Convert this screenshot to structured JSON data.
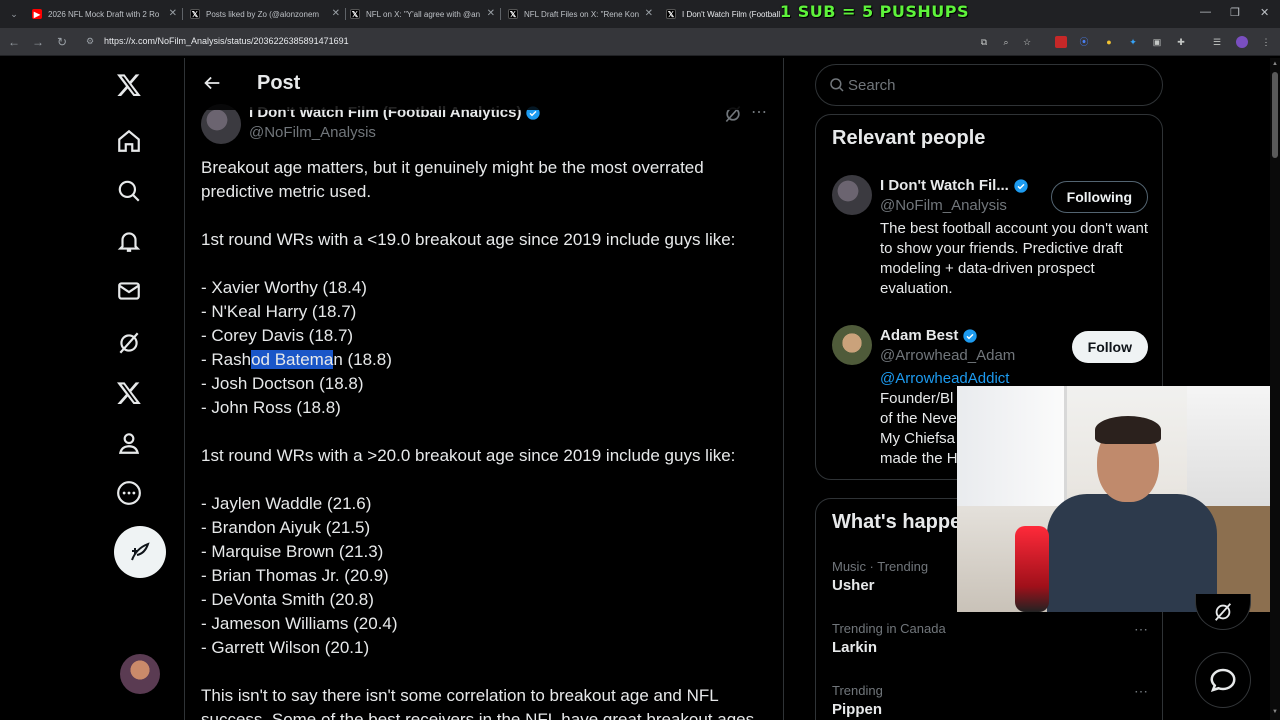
{
  "browser": {
    "tabs": [
      {
        "title": "2026 NFL Mock Draft with 2 Ro",
        "favicon": "youtube-icon",
        "color": "#ff0000"
      },
      {
        "title": "Posts liked by Zo (@alonzonem",
        "favicon": "x-icon",
        "color": "#000000"
      },
      {
        "title": "NFL on X: \"Y'all agree with @an",
        "favicon": "x-icon",
        "color": "#000000"
      },
      {
        "title": "NFL Draft Files on X: \"Rene Kon",
        "favicon": "x-icon",
        "color": "#000000"
      },
      {
        "title": "I Don't Watch Film (Football",
        "favicon": "x-icon",
        "color": "#000000"
      }
    ],
    "url": "https://x.com/NoFilm_Analysis/status/2036226385891471691",
    "overlay_banner": "1 SUB = 5 PUSHUPS"
  },
  "nav": {
    "items": [
      "x-logo",
      "home",
      "explore",
      "notifications",
      "messages",
      "grok",
      "premium",
      "profile",
      "more"
    ]
  },
  "post": {
    "header_title": "Post",
    "author_name": "I Don't Watch Film (Football Analytics)",
    "author_handle": "@NoFilm_Analysis",
    "body": {
      "intro_1": "Breakout age matters, but it genuinely might be the most overrated",
      "intro_2": "predictive metric used.",
      "list1_heading": "1st round WRs with a <19.0 breakout age since 2019 include guys like:",
      "list1": [
        "- Xavier Worthy (18.4)",
        "- N'Keal Harry (18.7)",
        "- Corey Davis (18.7)",
        "- Rashod Bateman (18.8)",
        "- Josh Doctson (18.8)",
        "- John Ross (18.8)"
      ],
      "list2_heading": "1st round WRs with a >20.0 breakout age since 2019 include guys like:",
      "list2": [
        "- Jaylen Waddle (21.6)",
        "- Brandon Aiyuk (21.5)",
        "- Marquise Brown (21.3)",
        "- Brian Thomas Jr. (20.9)",
        "- DeVonta Smith (20.8)",
        "- Jameson Williams (20.4)",
        "- Garrett Wilson (20.1)"
      ],
      "outro_1": "This isn't to say there isn't some correlation to breakout age and NFL",
      "outro_2": "success. Some of the best receivers in the NFL have great breakout ages."
    },
    "selection": {
      "before": "- Rash",
      "selected": "od Batema",
      "after": "n (18.8)"
    }
  },
  "search": {
    "placeholder": "Search"
  },
  "relevant": {
    "title": "Relevant people",
    "people": [
      {
        "name": "I Don't Watch Fil...",
        "handle": "@NoFilm_Analysis",
        "bio": "The best football account you don't want to show your friends. Predictive draft modeling + data-driven prospect evaluation.",
        "button": "Following"
      },
      {
        "name": "Adam Best",
        "handle": "@Arrowhead_Adam",
        "link": "@ArrowheadAddict",
        "bio_lines": [
          "Founder/Bl",
          "of the Neve",
          "My Chiefsa",
          "made the H"
        ],
        "button": "Follow"
      }
    ]
  },
  "trending": {
    "title": "What's happe",
    "items": [
      {
        "category": "Music · Trending",
        "name": "Usher"
      },
      {
        "category": "Trending in Canada",
        "name": "Larkin"
      },
      {
        "category": "Trending",
        "name": "Pippen"
      }
    ]
  },
  "colors": {
    "accent": "#1d9bf0",
    "background": "#000000",
    "border": "#2f3336",
    "muted": "#71767b",
    "banner": "#5ef33b"
  }
}
